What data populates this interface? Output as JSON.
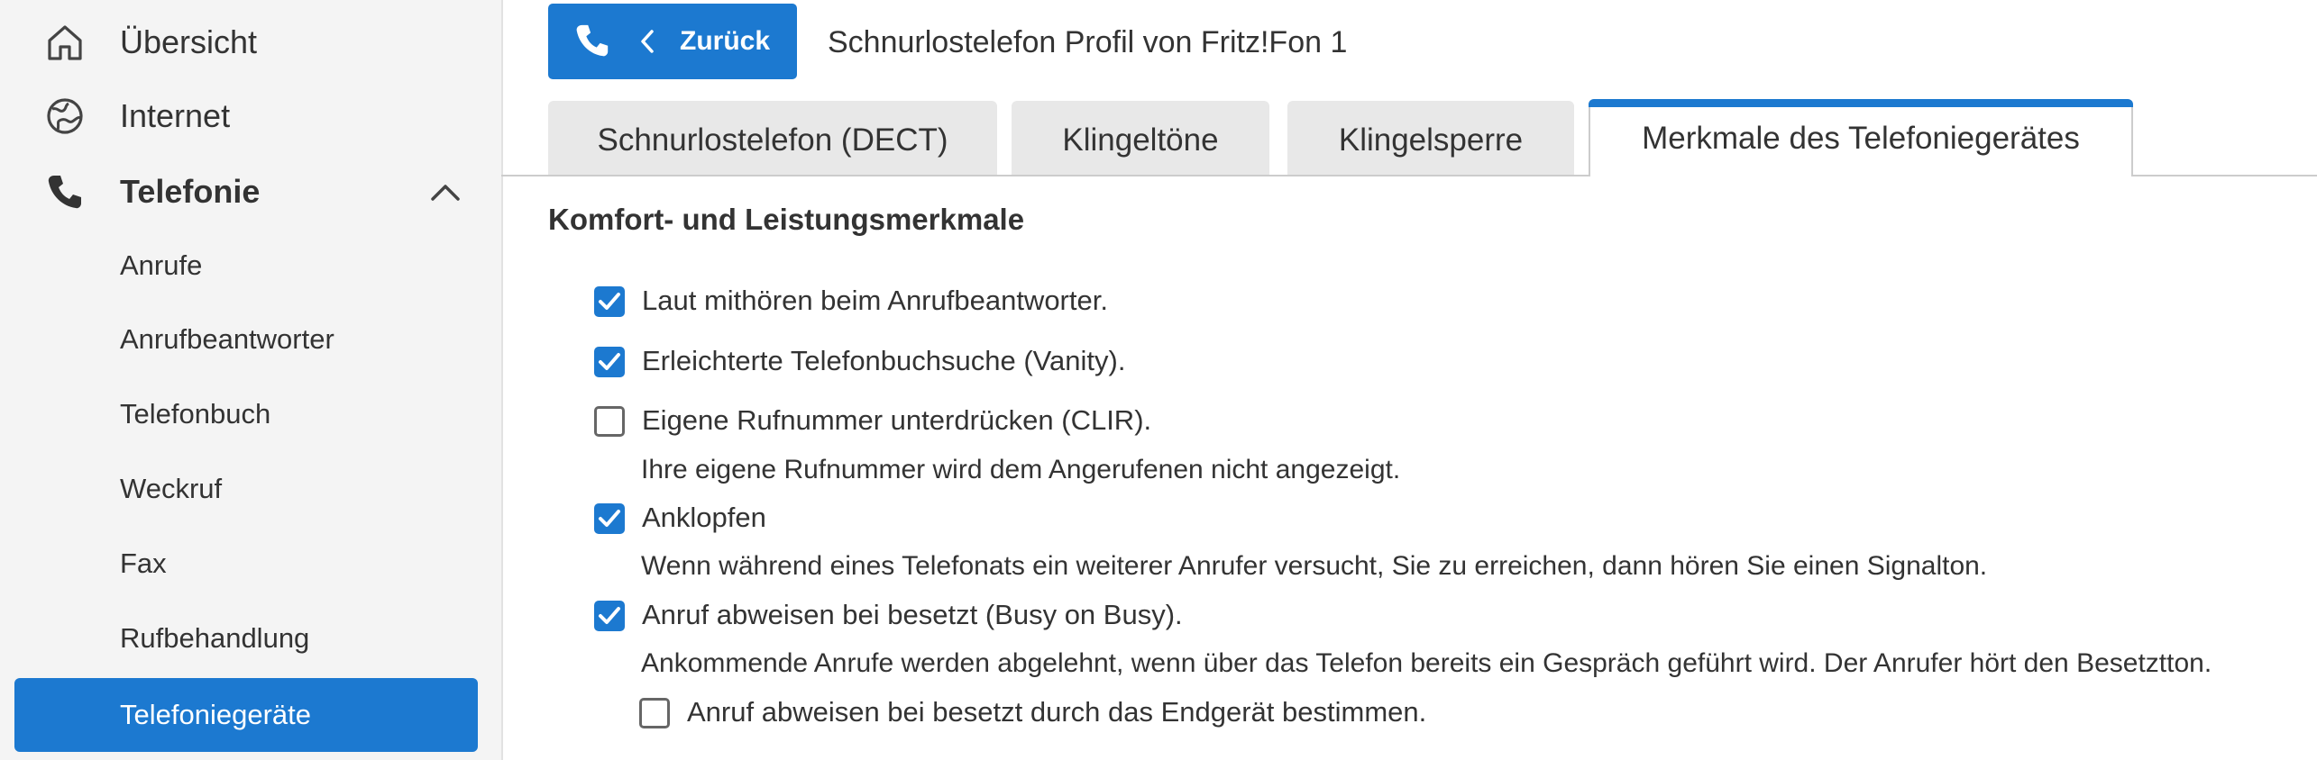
{
  "sidebar": {
    "top_items": [
      {
        "label": "Übersicht",
        "icon": "home-icon"
      },
      {
        "label": "Internet",
        "icon": "globe-icon"
      },
      {
        "label": "Telefonie",
        "icon": "phone-icon",
        "expanded": true
      }
    ],
    "sub_items": [
      {
        "label": "Anrufe"
      },
      {
        "label": "Anrufbeantworter"
      },
      {
        "label": "Telefonbuch"
      },
      {
        "label": "Weckruf"
      },
      {
        "label": "Fax"
      },
      {
        "label": "Rufbehandlung"
      },
      {
        "label": "Telefoniegeräte",
        "selected": true
      }
    ]
  },
  "header": {
    "back_label": "Zurück",
    "title": "Schnurlostelefon Profil von Fritz!Fon 1"
  },
  "tabs": [
    {
      "label": "Schnurlostelefon (DECT)"
    },
    {
      "label": "Klingeltöne"
    },
    {
      "label": "Klingelsperre"
    },
    {
      "label": "Merkmale des Telefoniegerätes",
      "active": true
    }
  ],
  "content": {
    "section_title": "Komfort- und Leistungsmerkmale",
    "options": [
      {
        "label": "Laut mithören beim Anrufbeantworter.",
        "checked": true
      },
      {
        "label": "Erleichterte Telefonbuchsuche (Vanity).",
        "checked": true
      },
      {
        "label": "Eigene Rufnummer unterdrücken (CLIR).",
        "checked": false,
        "description": "Ihre eigene Rufnummer wird dem Angerufenen nicht angezeigt."
      },
      {
        "label": "Anklopfen",
        "checked": true,
        "description": "Wenn während eines Telefonats ein weiterer Anrufer versucht, Sie zu erreichen, dann hören Sie einen Signalton."
      },
      {
        "label": "Anruf abweisen bei besetzt (Busy on Busy).",
        "checked": true,
        "description": "Ankommende Anrufe werden abgelehnt, wenn über das Telefon bereits ein Gespräch geführt wird. Der Anrufer hört den Besetztton."
      },
      {
        "label": "Anruf abweisen bei besetzt durch das Endgerät bestimmen.",
        "checked": false
      }
    ]
  },
  "colors": {
    "accent": "#1c79d0",
    "sidebar_bg": "#f4f4f4",
    "tab_bg": "#e8e8e8",
    "text": "#333333"
  }
}
